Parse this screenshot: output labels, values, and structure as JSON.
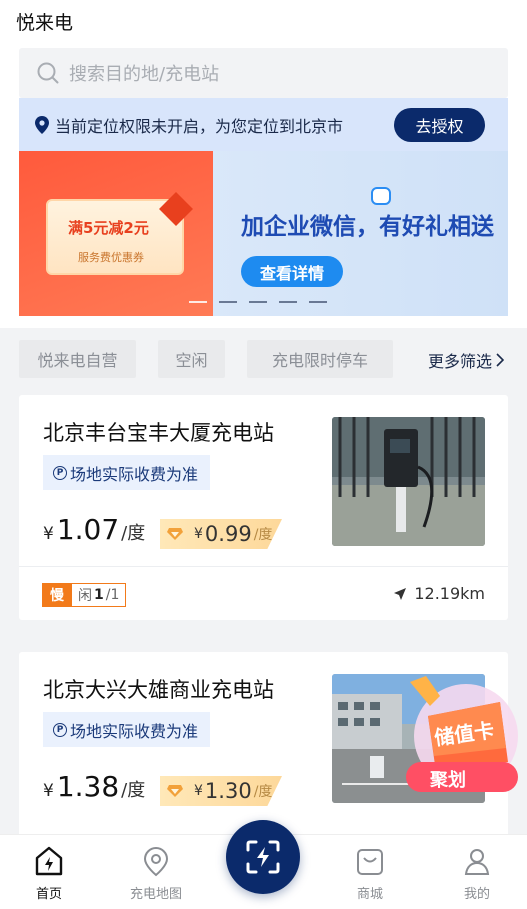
{
  "app": {
    "title": "悦来电"
  },
  "search": {
    "placeholder": "搜索目的地/充电站"
  },
  "location_notice": {
    "text": "当前定位权限未开启，为您定位到北京市",
    "button_label": "去授权"
  },
  "banner": {
    "coupon_title": "满5元减2元",
    "coupon_subtitle": "服务费优惠券",
    "headline": "加企业微信，有好礼相送",
    "button_label": "查看详情",
    "page_count": 5,
    "active_index": 0
  },
  "filters": {
    "chips": [
      "悦来电自营",
      "空闲",
      "充电限时停车"
    ],
    "more_label": "更多筛选"
  },
  "stations": [
    {
      "name": "北京丰台宝丰大厦充电站",
      "tag": "场地实际收费为准",
      "currency": "¥",
      "price": "1.07",
      "unit": "/度",
      "member_price": "0.99",
      "member_unit": "/度",
      "speed": "慢",
      "free_label": "闲",
      "free_count": "1",
      "total_count": "/1",
      "distance": "12.19km"
    },
    {
      "name": "北京大兴大雄商业充电站",
      "tag": "场地实际收费为准",
      "currency": "¥",
      "price": "1.38",
      "unit": "/度",
      "member_price": "1.30",
      "member_unit": "/度"
    }
  ],
  "promo": {
    "line1": "储值卡",
    "line2": "聚划"
  },
  "tabbar": {
    "items": [
      {
        "label": "首页",
        "icon": "home-icon",
        "active": true
      },
      {
        "label": "充电地图",
        "icon": "map-pin-icon",
        "active": false
      },
      {
        "label": "商城",
        "icon": "shop-bag-icon",
        "active": false
      },
      {
        "label": "我的",
        "icon": "user-icon",
        "active": false
      }
    ],
    "center_icon": "scan-charge-icon"
  },
  "colors": {
    "primary": "#0b2a6b",
    "accent_orange": "#f27a1a",
    "location_bar_bg": "#d8e5fb",
    "tag_bg": "#eaf1fd"
  }
}
